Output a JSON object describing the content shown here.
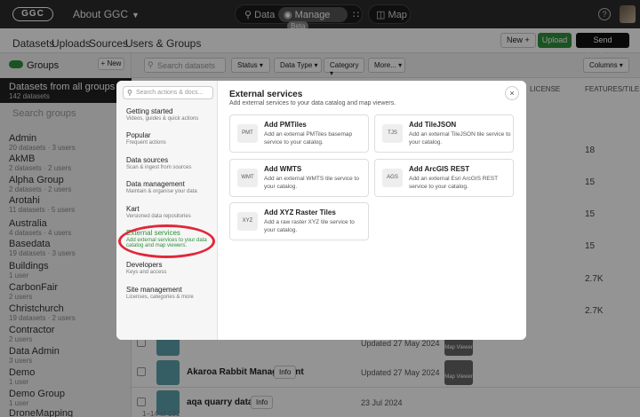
{
  "header": {
    "logo": "GGC",
    "about": "About GGC",
    "modes": {
      "data": "Data",
      "manage": "Manage",
      "beta": "Beta",
      "map": "Map"
    },
    "help": "?"
  },
  "nav": {
    "links": [
      "Datasets",
      "Uploads",
      "Sources",
      "Users & Groups"
    ],
    "new_label": "New +",
    "upload_label": "Upload",
    "feedback_label": "Send feedback"
  },
  "sidebar": {
    "groups_label": "Groups",
    "new_label": "+ New",
    "all_groups": {
      "title": "Datasets from all groups",
      "count": "142 datasets"
    },
    "search_placeholder": "Search groups",
    "groups": [
      {
        "name": "Admin",
        "count": "20 datasets · 3 users"
      },
      {
        "name": "AkMB",
        "count": "2 datasets · 2 users"
      },
      {
        "name": "Alpha Group",
        "count": "2 datasets · 2 users"
      },
      {
        "name": "Arotahi",
        "count": "11 datasets · 5 users"
      },
      {
        "name": "Australia",
        "count": "4 datasets · 4 users"
      },
      {
        "name": "Basedata",
        "count": "19 datasets · 3 users"
      },
      {
        "name": "Buildings",
        "count": "1 user"
      },
      {
        "name": "CarbonFair",
        "count": "2 users"
      },
      {
        "name": "Christchurch",
        "count": "19 datasets · 2 users"
      },
      {
        "name": "Contractor",
        "count": "2 users"
      },
      {
        "name": "Data Admin",
        "count": "3 users"
      },
      {
        "name": "Demo",
        "count": "1 user"
      },
      {
        "name": "Demo Group",
        "count": "1 user"
      },
      {
        "name": "DroneMapping",
        "count": ""
      }
    ]
  },
  "main": {
    "search_placeholder": "Search datasets",
    "filters": [
      "Status",
      "Data Type",
      "Category",
      "More..."
    ],
    "columns_label": "Columns",
    "col_license": "LICENSE",
    "col_features": "FEATURES/TILES",
    "feature_values": [
      "18",
      "15",
      "15",
      "15",
      "2.7K",
      "2.7K"
    ],
    "rows": [
      {
        "name": "",
        "info": "",
        "date": "Updated 27 May 2024",
        "map": "Map Viewer"
      },
      {
        "name": "Akaroa Rabbit Management",
        "info": "Info",
        "date": "Updated 27 May 2024",
        "map": "Map Viewer"
      },
      {
        "name": "aqa quarry database",
        "info": "Info",
        "date": "23 Jul 2024",
        "map": ""
      }
    ],
    "footer": "1–14 of 131"
  },
  "modal": {
    "search_placeholder": "Search actions & docs...",
    "categories": [
      {
        "name": "Getting started",
        "desc": "Videos, guides & quick actions"
      },
      {
        "name": "Popular",
        "desc": "Frequent actions"
      },
      {
        "name": "Data sources",
        "desc": "Scan & ingest from sources"
      },
      {
        "name": "Data management",
        "desc": "Maintain & organise your data"
      },
      {
        "name": "Kart",
        "desc": "Versioned data repositories"
      },
      {
        "name": "External services",
        "desc": "Add external services to your data catalog and map viewers."
      },
      {
        "name": "Developers",
        "desc": "Keys and access"
      },
      {
        "name": "Site management",
        "desc": "Licenses, categories & more"
      }
    ],
    "title": "External services",
    "subtitle": "Add external services to your data catalog and map viewers.",
    "close": "×",
    "cards": [
      {
        "code": "PMT",
        "title": "Add PMTiles",
        "desc": "Add an external PMTiles basemap service to your catalog."
      },
      {
        "code": "TJS",
        "title": "Add TileJSON",
        "desc": "Add an external TileJSON tile service to your catalog."
      },
      {
        "code": "WMT",
        "title": "Add WMTS",
        "desc": "Add an external WMTS tile service to your catalog."
      },
      {
        "code": "AGS",
        "title": "Add ArcGIS REST",
        "desc": "Add an external Esri ArcGIS REST service to your catalog."
      },
      {
        "code": "XYZ",
        "title": "Add XYZ Raster Tiles",
        "desc": "Add a raw raster XYZ tile service to your catalog."
      }
    ]
  }
}
